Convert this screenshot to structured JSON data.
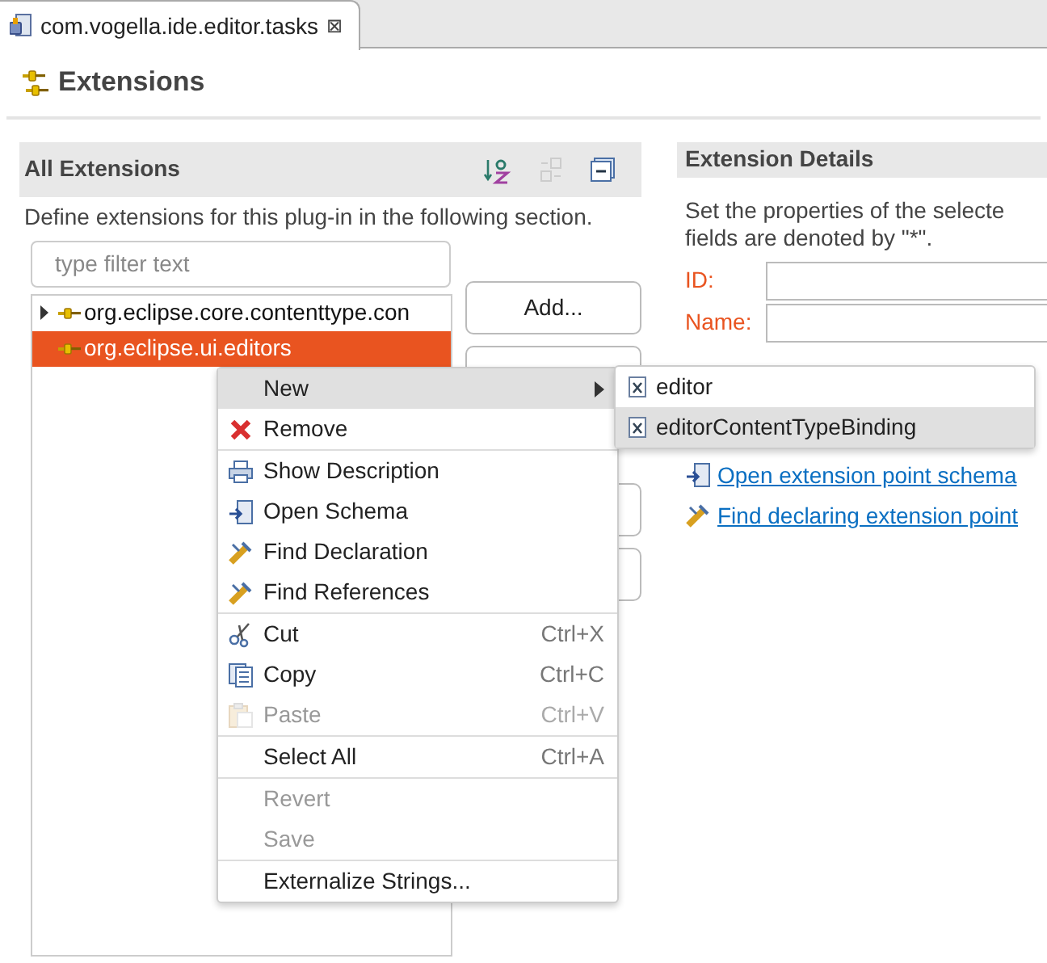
{
  "editor_tab": {
    "title": "com.vogella.ide.editor.tasks",
    "close": "⊠",
    "selected": true
  },
  "page_title": "Extensions",
  "all_extensions": {
    "title": "All Extensions",
    "description": "Define extensions for this plug-in in the following section.",
    "filter": {
      "placeholder": "type filter text"
    },
    "tree": [
      {
        "label": "org.eclipse.core.contenttype.con",
        "expanded": false,
        "selected": false
      },
      {
        "label": "org.eclipse.ui.editors",
        "selected": true
      }
    ],
    "buttons": [
      {
        "label": "Add..."
      }
    ]
  },
  "extension_details": {
    "title": "Extension Details",
    "description": "Set the properties of the selecte\nfields are denoted by \"*\".",
    "fields": [
      {
        "label": "ID:"
      },
      {
        "label": "Name:"
      }
    ],
    "links": [
      "Open extension point schema",
      "Find declaring extension point"
    ]
  },
  "context_menu": {
    "groups": [
      [
        {
          "label": "New",
          "disabled": false,
          "selected": true,
          "submenu": true
        },
        {
          "label": "Remove",
          "disabled": false,
          "selected": false,
          "submenu": false
        }
      ],
      [
        {
          "label": "Show Description",
          "disabled": false,
          "selected": false,
          "submenu": false
        },
        {
          "label": "Open Schema",
          "disabled": false,
          "selected": false,
          "submenu": false
        },
        {
          "label": "Find Declaration",
          "disabled": false,
          "selected": false,
          "submenu": false
        },
        {
          "label": "Find References",
          "disabled": false,
          "selected": false,
          "submenu": false
        }
      ],
      [
        {
          "label": "Cut",
          "shortcut": "Ctrl+X",
          "disabled": false,
          "selected": false,
          "submenu": false
        },
        {
          "label": "Copy",
          "shortcut": "Ctrl+C",
          "disabled": false,
          "selected": false,
          "submenu": false
        },
        {
          "label": "Paste",
          "shortcut": "Ctrl+V",
          "disabled": true,
          "selected": false,
          "submenu": false
        }
      ],
      [
        {
          "label": "Select All",
          "shortcut": "Ctrl+A",
          "disabled": false,
          "selected": false,
          "submenu": false
        }
      ],
      [
        {
          "label": "Revert",
          "disabled": true,
          "selected": false,
          "submenu": false
        },
        {
          "label": "Save",
          "disabled": true,
          "selected": false,
          "submenu": false
        }
      ],
      [
        {
          "label": "Externalize Strings...",
          "disabled": false,
          "selected": false,
          "submenu": false
        }
      ]
    ]
  },
  "submenu": [
    {
      "label": "editor",
      "selected": false
    },
    {
      "label": "editorContentTypeBinding",
      "selected": true
    }
  ]
}
